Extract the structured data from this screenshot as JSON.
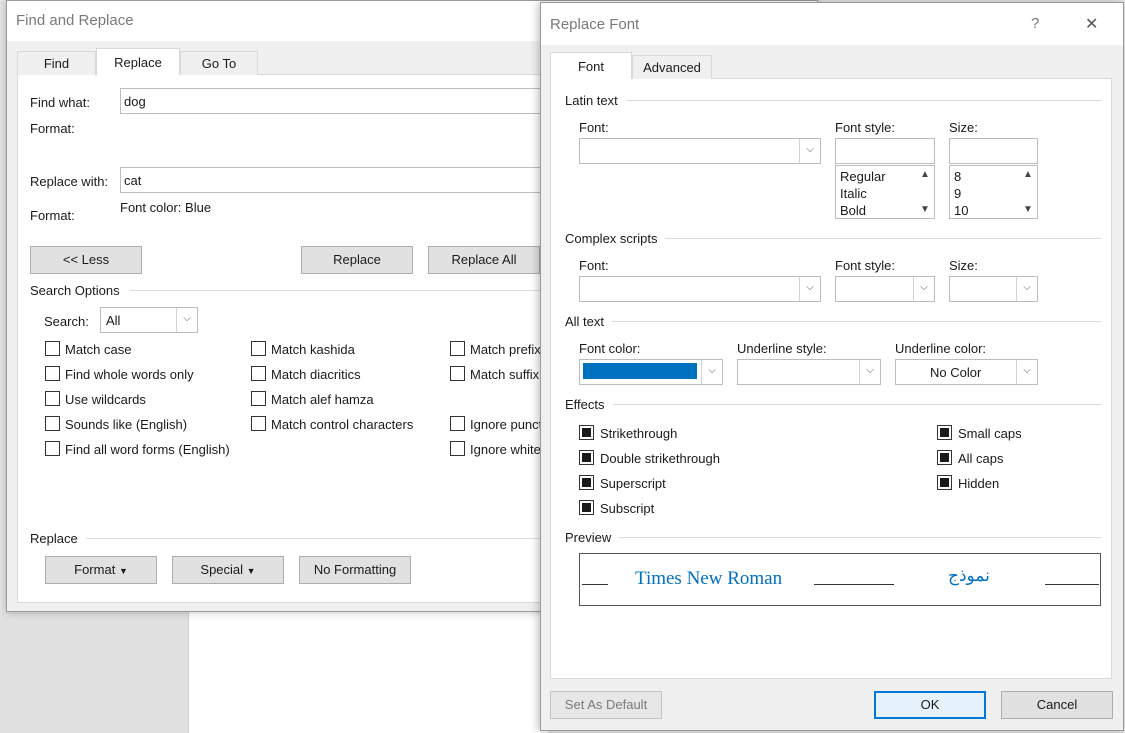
{
  "find_replace": {
    "title": "Find and Replace",
    "tabs": [
      "Find",
      "Replace",
      "Go To"
    ],
    "find_what_label": "Find what:",
    "find_what_value": "dog",
    "format_label_1": "Format:",
    "replace_with_label": "Replace with:",
    "replace_with_value": "cat",
    "format_label_2": "Format:",
    "replace_format_value": "Font color: Blue",
    "less_button": "<< Less",
    "replace_button": "Replace",
    "replace_all_button": "Replace All",
    "search_options_title": "Search Options",
    "search_label": "Search:",
    "search_value": "All",
    "options_col1": [
      "Match case",
      "Find whole words only",
      "Use wildcards",
      "Sounds like (English)",
      "Find all word forms (English)"
    ],
    "options_col2": [
      "Match kashida",
      "Match diacritics",
      "Match alef hamza",
      "Match control characters"
    ],
    "options_col3": [
      "Match prefix",
      "Match suffix",
      "Ignore punct",
      "Ignore white"
    ],
    "replace_section_title": "Replace",
    "format_button": "Format",
    "special_button": "Special",
    "no_formatting_button": "No Formatting"
  },
  "replace_font": {
    "title": "Replace Font",
    "help_glyph": "?",
    "close_glyph": "✕",
    "tabs": [
      "Font",
      "Advanced"
    ],
    "latin_text_title": "Latin text",
    "font_label": "Font:",
    "font_style_label": "Font style:",
    "size_label": "Size:",
    "font_styles": [
      "Regular",
      "Italic",
      "Bold"
    ],
    "sizes": [
      "8",
      "9",
      "10"
    ],
    "complex_scripts_title": "Complex scripts",
    "all_text_title": "All text",
    "font_color_label": "Font color:",
    "font_color_value": "#0070c0",
    "underline_style_label": "Underline style:",
    "underline_color_label": "Underline color:",
    "underline_color_value": "No Color",
    "effects_title": "Effects",
    "effects_left": [
      "Strikethrough",
      "Double strikethrough",
      "Superscript",
      "Subscript"
    ],
    "effects_right": [
      "Small caps",
      "All caps",
      "Hidden"
    ],
    "preview_title": "Preview",
    "preview_latin": "Times New Roman",
    "preview_complex": "نموذج",
    "set_default_button": "Set As Default",
    "ok_button": "OK",
    "cancel_button": "Cancel"
  }
}
